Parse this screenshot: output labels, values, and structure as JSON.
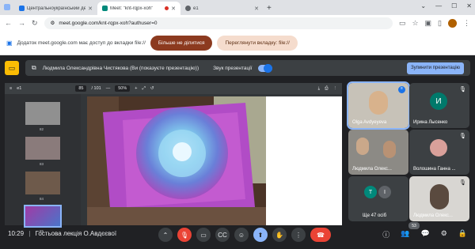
{
  "browser": {
    "tabs": [
      {
        "label": "Центральноукраїнський держ",
        "color": "#1a73e8",
        "active": false
      },
      {
        "label": "Meet: \"knt-rqpx-xoh\"",
        "color": "#00897b",
        "active": true
      },
      {
        "label": "e1",
        "color": "#5f6368",
        "active": false
      }
    ],
    "url": "meet.google.com/knt-rqpx-xoh?authuser=0"
  },
  "share_notice": {
    "text": "Додаток meet.google.com має доступ до вкладки file://",
    "stop_label": "Більше не ділитися",
    "switch_label": "Переглянути вкладку: file://"
  },
  "presentation": {
    "presenter_text": "Людмила Олександрівна Чистякова (Ви (показуєте презентацію))",
    "sound_label": "Звук презентації",
    "stop_button": "Зупинити презентацію"
  },
  "pdf": {
    "doc_name": "e1",
    "page_current": "85",
    "page_total": "/ 101",
    "zoom": "50%",
    "thumb_numbers": [
      "82",
      "83",
      "84",
      "85"
    ]
  },
  "participants": [
    {
      "name": "Olga Avdyeyeva",
      "type": "video"
    },
    {
      "name": "Ирина Лысенко",
      "initial": "И",
      "color": "#00796b"
    },
    {
      "name": "Людмила Олекс...",
      "type": "video"
    },
    {
      "name": "Волошина Ганна ...",
      "type": "video"
    },
    {
      "name": "Ще 47 осіб",
      "initials": [
        "Т",
        "І"
      ]
    },
    {
      "name": "Людмила Олекс...",
      "type": "video"
    }
  ],
  "bottom": {
    "time": "10:29",
    "meeting_name": "Гостьова лекція О.Авдєєвої",
    "people_count": "53"
  }
}
